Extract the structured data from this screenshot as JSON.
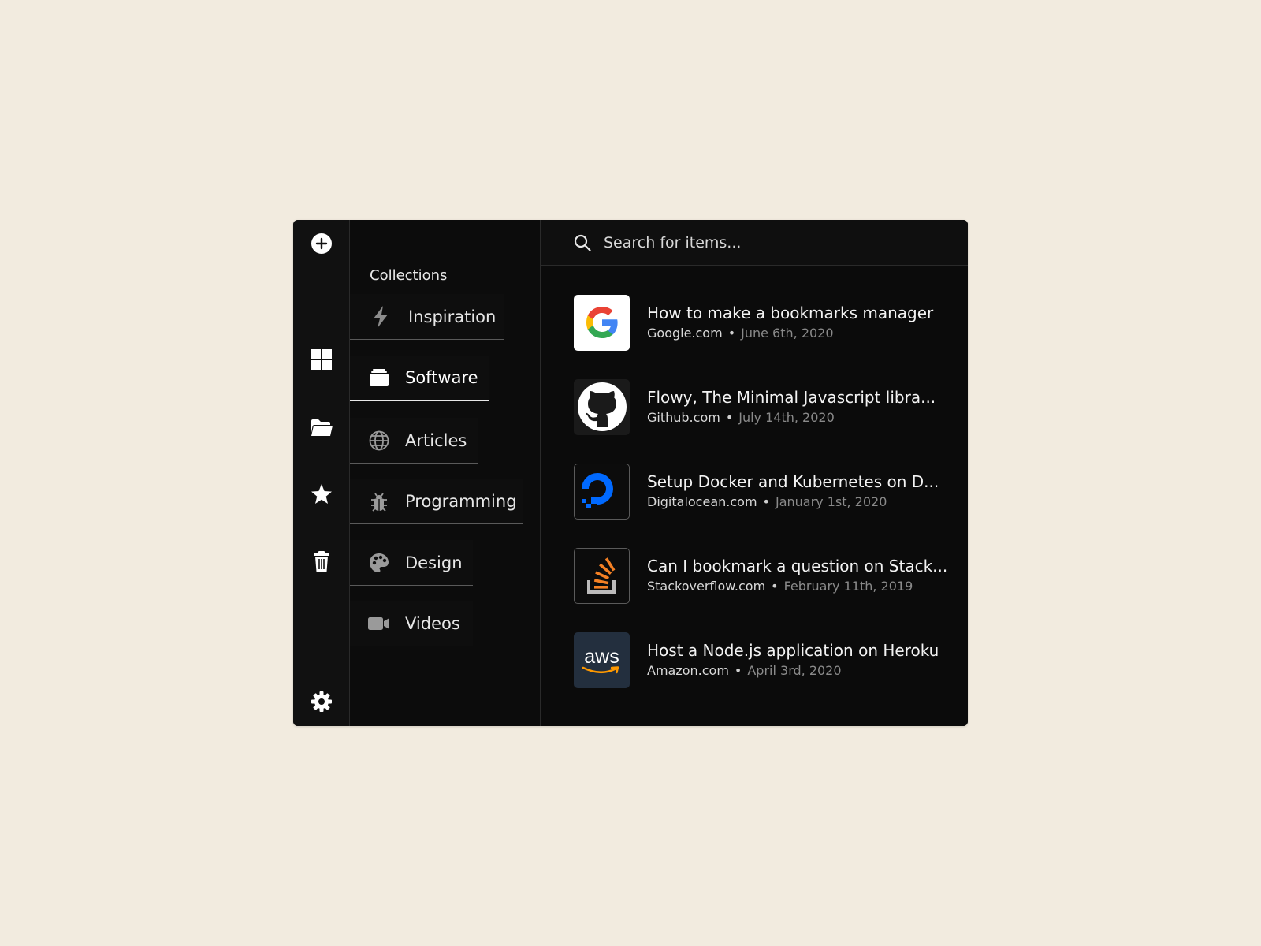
{
  "sidebar": {
    "icons": [
      "add-icon",
      "grid-icon",
      "folder-icon",
      "star-icon",
      "trash-icon",
      "settings-icon"
    ]
  },
  "collections": {
    "title": "Collections",
    "items": [
      {
        "label": "Inspiration",
        "icon": "lightning-icon"
      },
      {
        "label": "Software",
        "icon": "package-icon"
      },
      {
        "label": "Articles",
        "icon": "globe-icon"
      },
      {
        "label": "Programming",
        "icon": "bug-icon"
      },
      {
        "label": "Design",
        "icon": "palette-icon"
      },
      {
        "label": "Videos",
        "icon": "video-icon"
      }
    ],
    "active": "Software"
  },
  "search": {
    "placeholder": "Search for items..."
  },
  "bookmarks": [
    {
      "title": "How to make a bookmarks manager",
      "domain": "Google.com",
      "date": "June 6th, 2020",
      "icon": "google-logo"
    },
    {
      "title": "Flowy, The Minimal Javascript libra...",
      "domain": "Github.com",
      "date": "July 14th, 2020",
      "icon": "github-logo"
    },
    {
      "title": "Setup Docker and Kubernetes on D...",
      "domain": "Digitalocean.com",
      "date": "January 1st, 2020",
      "icon": "digitalocean-logo"
    },
    {
      "title": "Can I bookmark a question on Stack...",
      "domain": "Stackoverflow.com",
      "date": "February 11th, 2019",
      "icon": "stackoverflow-logo"
    },
    {
      "title": "Host a Node.js application on Heroku",
      "domain": "Amazon.com",
      "date": "April 3rd, 2020",
      "icon": "aws-logo",
      "logo_text": "aws"
    }
  ],
  "colors": {
    "page_background": "#f2ebdf",
    "app_background": "#0c0c0c",
    "text_primary": "#f3f3f3",
    "text_muted": "#8a8a8a",
    "digitalocean_blue": "#0069ff",
    "stackoverflow_orange": "#f48024",
    "aws_orange": "#ff9900",
    "aws_navy": "#232f3e"
  }
}
